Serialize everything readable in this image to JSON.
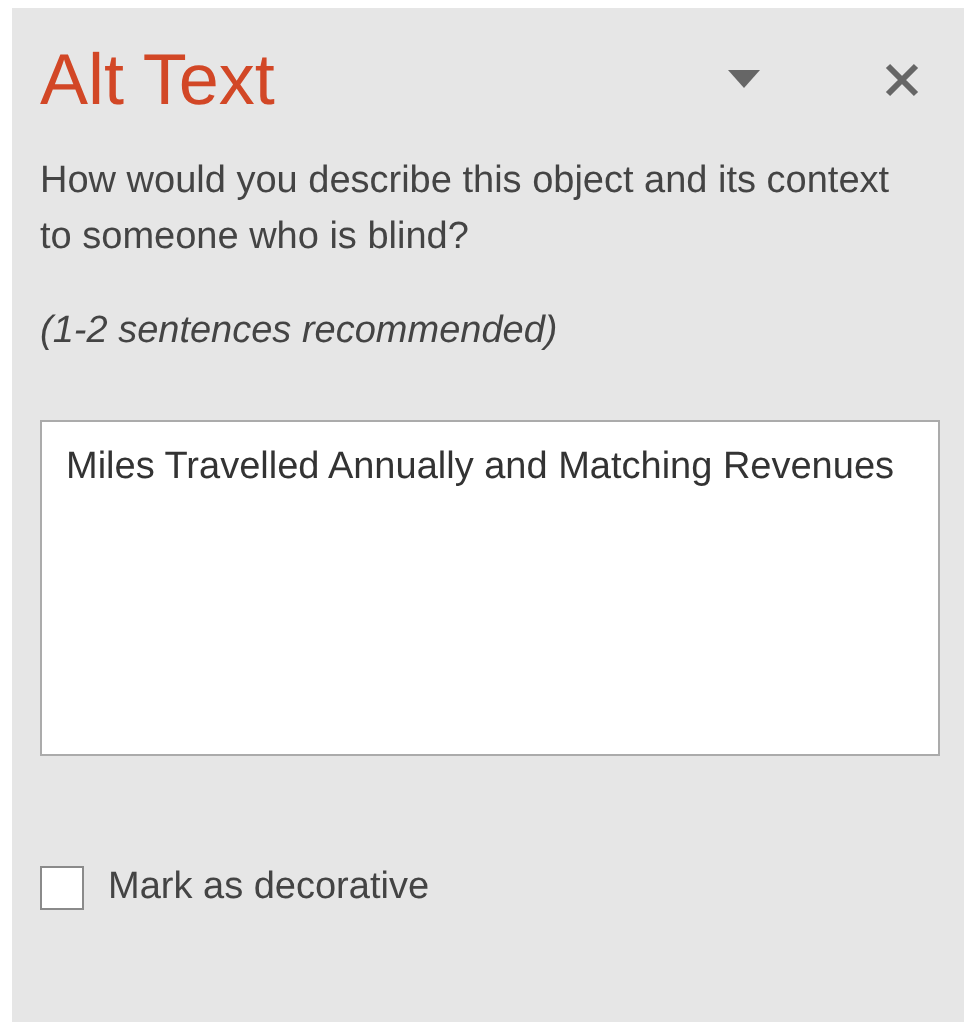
{
  "pane": {
    "title": "Alt Text"
  },
  "prompt": "How would you describe this object and its context to someone who is blind?",
  "hint": "(1-2 sentences recommended)",
  "description_field": {
    "value": "Miles Travelled Annually and Matching Revenues"
  },
  "decorative_checkbox": {
    "label": "Mark as decorative",
    "checked": false
  }
}
